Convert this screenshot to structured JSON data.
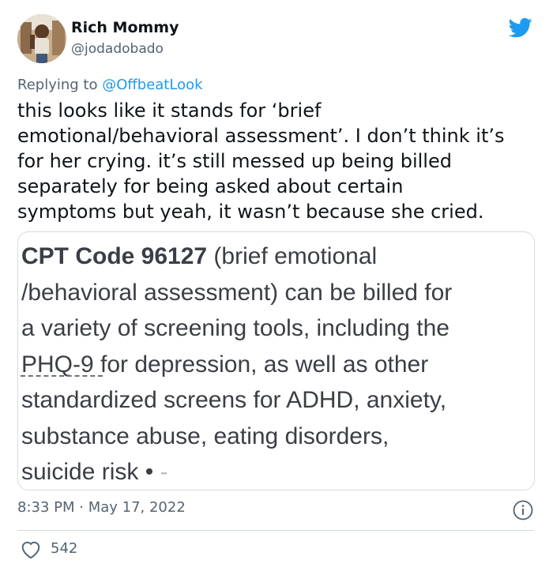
{
  "author": {
    "display_name": "Rich Mommy",
    "handle": "@jodadobado"
  },
  "reply": {
    "prefix": "Replying to ",
    "mention": "@OffbeatLook"
  },
  "tweet_text": "this looks like it stands for ‘brief\nemotional/behavioral assessment’. I don’t think it’s\nfor her crying. it’s still messed up being billed\nseparately for being asked about certain\nsymptoms but yeah, it wasn’t because she cried.",
  "card": {
    "code_title": "CPT Code 96127",
    "line1_rest": " (brief emotional",
    "line2": "/behavioral assessment) can be billed for",
    "line3": "a variety of screening tools, including the",
    "link_text": "PHQ-9",
    "line4_rest": " for depression, as well as other",
    "line5": "standardized screens for ADHD, anxiety,",
    "line6": "substance abuse, eating disorders,",
    "line7": "suicide risk • ",
    "line7_faded": "-"
  },
  "timestamp": "8:33 PM · May 17, 2022",
  "likes": "542",
  "icons": {
    "brand": "twitter-bird-icon",
    "info": "info-icon",
    "like": "heart-icon"
  },
  "colors": {
    "accent": "#1d9bf0",
    "secondary_text": "#536471",
    "primary_text": "#0f1419"
  }
}
